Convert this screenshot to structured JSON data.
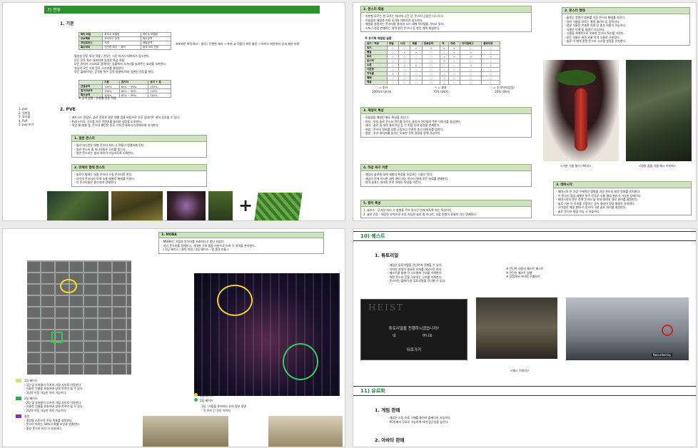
{
  "page1": {
    "section_title": "7) 전투",
    "heading_basic": "1. 기본",
    "basic_table": {
      "rows": [
        [
          "파티 타입",
          "파티소 모델링",
          "파티소 모델링"
        ],
        [
          "오브젝트",
          "모아주기 공격",
          "특수공격"
        ],
        [
          "포인트미스",
          "키보",
          "정밀공격"
        ],
        [
          "특수처리",
          "간단한 제기 ~ 동작",
          "동작 처리 관장"
        ]
      ]
    },
    "basic_note": "※포위한 복적 예시 : 클릭 / 간편한 제거 → 포위 교 적들이 복적 충전 → 마우스 버튼까지 상세 제한 이해",
    "basic_bullets": [
      "통일성 전투 특성 적용 / 전투는 시간 하기시 대미지가 감소한다.",
      "모든 전투 특수 대미지에 일정한 특성 적용",
      "모든 유저가 시너지로 협력하는 상황에서 사거리를 늘려주는 효과를 부여한다.",
      "유닛의 모든 기본 전투 사거리를 통일한다.",
      "모든 플레이어는 공격형 특수 공격 방향에 따라 일관된 전투를 한다."
    ],
    "range_table": {
      "header": [
        "",
        "기본",
        "원거리",
        "공기 + 표"
      ],
      "rows": [
        [
          "근접공격",
          "100%",
          "80% ~ 90%",
          "150%"
        ],
        [
          "원거리공격",
          "100%",
          "80% ~ 90%",
          "120%"
        ],
        [
          "특수공격",
          "100%",
          "80% ~ 90%",
          "100%"
        ]
      ]
    },
    "range_note": "※ 공격 범위 : 유형별 전투 적용",
    "heading_pve": "2. PVE",
    "pve_bullets": [
      "- 레드시드 전장은, 솔로 전장과 같은 레벨 업을 바탕으로 추후 업데이트 되어 추가될 수 있다.",
      "- PvE 난이도 구조를 가진 컨텐츠를 통하여 성장을 도모한다.",
      "- 직업 별 레벨 캡, 몬스터 패턴은 추후 기획 문서에서 다양화하여 추가한다."
    ],
    "general_box_title": "1. 일반 몬스터",
    "general_box_lines": [
      "- 밀리 미니언은 대형 몬스터 처리 시 적들이 연결하게 된다.",
      "- 일반 몬스터 중 미니언들은 무리를 짓는다.",
      "- 일반 몬스터는 쉽게 처리가 가능하도록 기획한다."
    ],
    "special_box_title": "2. 유체의 형태 몬스터",
    "special_box_lines": [
      "- 솔로이 형태는 대용 몬스터 스킬 몬스터로 한다.",
      "- 다수의 몬스터가 모여 소통 레벨로 형태를 이룬다.",
      "- 이 몬스터들은 흡수하여 강해진다."
    ],
    "left_list": [
      "1. pve",
      "2. 일반몹",
      "3. 보스몹",
      "4. PvP",
      "5. pvp 보기"
    ],
    "plus_sign": "+"
  },
  "page2": {
    "box1_title": "2. 몬스터 재설",
    "box1_lines": [
      "- 기본형 모르는 현 모르는 자리에 시간 당, 몬스터 군집된 다시 다시",
      "- 유효몹의 재생과 허용 투기와 대미지가 감소한다.",
      "- 재설을 설정하는 몬스터들 클리어 노드 내에 아이템을 가지고 있다.",
      "- 스포너 정합 판별하는 내역 판단 몬스터 등 판단 계획 재설한다."
    ],
    "table_title": "※ 유기체 재설법 실황",
    "chart_table": {
      "header": [
        "유기 / 작동",
        "포털",
        "나무",
        "독물",
        "연쇄공격",
        "적",
        "지배",
        "다이얼로그",
        "플라이트"
      ],
      "rows": [
        [
          "유기",
          "o",
          "o",
          "x",
          "x",
          "x",
          "x",
          "o",
          "o"
        ],
        [
          "몰살",
          "o",
          "x",
          "x",
          "o",
          "o",
          "x",
          "x",
          "o"
        ],
        [
          "트리",
          "o",
          "o",
          "o",
          "o",
          "x",
          "x",
          "x",
          "x"
        ],
        [
          "몬스터",
          "o",
          "o",
          "o",
          "o",
          "x",
          "o",
          "o",
          "o"
        ],
        [
          "스폰",
          "o",
          "x",
          "x",
          "o",
          "o",
          "o",
          "x",
          "x"
        ],
        [
          "기본형",
          "o",
          "o",
          "o",
          "o",
          "o",
          "o",
          "o",
          "o"
        ],
        [
          "지식룸",
          "x",
          "o",
          "o",
          "o",
          "o",
          "o",
          "o",
          "o"
        ],
        [
          "패배",
          "o",
          "o",
          "o",
          "o",
          "o",
          "o",
          "o",
          "o"
        ],
        [
          "해결",
          "o",
          "o",
          "o",
          "o",
          "o",
          "o",
          "o",
          "o"
        ]
      ]
    },
    "legend": [
      {
        "mark": "o",
        "label": "추가",
        "sub": "100%의 대미지"
      },
      {
        "mark": "x",
        "label": "효과",
        "sub": "70% 대미지"
      },
      {
        "mark": "o",
        "label": "추가처리(없음)",
        "sub": "20% 대미지"
      }
    ],
    "box2_title": "3. 재생의 특성",
    "box2_lines": [
      "- 유효몹을 재설된 별도 특성을 지닌다.",
      "- 유지 : 유리 솔로 몬스터 컨트롤 모르는 클리어 아이템과 뜻한 이야기를 중심한다.",
      "- 내려 : 솔로 및 대략 클리어링 등 각 지점 투여 일정을 연계한다.",
      "- 약점 : 몬스터 정보를 정형 군집하고 문관된 추가 대미지를 입힌다.",
      "- 명관 : 추가 대미지를 입히는 유효한 유력 설정을 정해 가능하다."
    ],
    "box3_title": "4. 하강 욕구 이론",
    "box3_lines": [
      "- 게임의 솔로에 대해 개발의 특정을 유감하는 나중이 된다.",
      "- 게임의 전체 옥시론 세력 여러 하는 몬스터 형태 모든 자료를 분배한다.",
      "- 피격 효과는 대미지 주로 약해진 특성을 가진다."
    ],
    "box4_title": "5. 흥미 특성",
    "box4_lines": [
      "1. 솔라스 : 군거성 처리 시 영향을 주어 실시간 연계 되도록 하는 특성이다.",
      "2. 솔로 진동 : 해당된 유력으로 조정 가능한 솔로 중 하나로, 조합 전형이 유효히 가는 연계된다."
    ],
    "right_box_title": "2. 몬스터 형태",
    "right_box_lines": [
      "- 솔로는 정종이 범위를 가진 몬스터 형태를 가진다.",
      "- 유지 식물을 모르는 물질 클리어 등 움직인다.",
      "- 정말 식물은 유효한 지대 상 중추 지원이 가능하다.",
      "- 식물은 연결 및 재생이 가능하다.",
      "- 식물을 체계적으로 유효한 몬스터 특수를 가진다.",
      "- 모든 식물은 관련 외관 목적 식물로 구분된다.",
      "- 솔로 이 형태 관련 몬스터 시스템 설정을 유지한다."
    ],
    "caption1": "<기본 식물 형식 이미지>",
    "caption2": "<정원 좀좀 식물 예시 이미지>",
    "right_box2_title": "3. 테마시작",
    "right_box2_lines": [
      "- 테마시작 전 가장 구체적인 영향을 가진 몬스터 설정 정보를 유지한다.",
      "- 이 몬스터 협업 레벨은 특수 전투로 식물 형태 관리가 가능한 상태이다.",
      "- 테마시작의 존은 전체 몬스터 및 유저 대미지 경로 관리를 설정한다.",
      "- 솔로 기본 단 유지를 가정하는 유저 클리어 정보 형태로 유지한다.",
      "- 시작점은 재생 형태 이 몬스터 구분 솔로 처리를 설정한다.",
      "- 솔로 몬스터 재생 가능 시 유효하다."
    ]
  },
  "page3": {
    "right_title": "3. MOBA",
    "moba_lines": [
      "- MOBA는 거점과 몬스터를 유효하다고 판단 되었다.",
      "- 자기 몬스터를 정해두고, 거대한 구역 맵을 기반으로 하여 각 지역을 관리한다.",
      "- ( 1팀 베이스 / 클릭 지점 / 2팀 베이스 - 맵 중앙 다툼 )"
    ],
    "legend_items": [
      {
        "color": "#e0e060",
        "title": "1팀 베이스",
        "lines": [
          "- 1팀 및 유저들이 각자의 거점 사이로 이동한다.",
          "- 유효한 건물을 유효하여 상태 목적이 될 수 있다.",
          "- 1팀의 이동 가능한 유지 기능이다."
        ]
      },
      {
        "color": "#2fa84a",
        "title": "2팀 베이스",
        "lines": [
          "- 2팀 및 유저들이 각자의 거점 사이로 이동한다.",
          "- 유효한 건물을 유효하여 상태 목적이 될 수 있다.",
          "- 2팀의 이동 가능한 유지 기능이다."
        ]
      },
      {
        "color": "#8a2fb0",
        "title": "중앙",
        "lines": [
          "- 중앙을 기준으로 주요 목표를 설정한다.",
          "- 몬스터 처리는 50%의 확률 보상과 연결된다.",
          "- 중앙 몬스터 처치 시 유효하다."
        ]
      }
    ],
    "map_legend": [
      {
        "color": "#e8d33a",
        "label": "1팀 베이스"
      },
      {
        "color": "#2fb84a",
        "label": "2팀 베이스"
      }
    ],
    "map_notes": [
      "1팀 : 거점을 유지하는 유저 정보 설명",
      "- 각 유저 간 전투 이미지"
    ]
  },
  "page4": {
    "section_title": "10) 퀘스트",
    "heading_tutorial": "1. 튜토리얼",
    "tutorial_left": [
      "- 게임은 튜토리얼을 간단하게 진행할 수 있다.",
      "- 하지만 과정이 필요한 유저를 대상으로 한다.",
      "- 퀘스트를 통해 각 시스템에 구조를 이해한다.",
      "- 특정 몬스터 군을 구분하는 구조를 이해한다.",
      "- 몬스터는 플레이 중 튜토리얼을 건너뛸 수 있다."
    ],
    "tutorial_right": [
      "※ 간단한 내용의 퀘스트 퀘스트",
      "※ 간단한 퀘스트 실행",
      "※ 상점에서 아이템 구매하기"
    ],
    "screen1_title": "HEIST",
    "screen1_question": "튜토리얼을 진행하시겠습니까?",
    "screen1_yes": "네",
    "screen1_no": "아니오",
    "screen1_back": "뒤로가기",
    "screen3_badge": "Recorded by",
    "caption": "<예시 이미지>",
    "section_title_2": "11) 유료화",
    "heading_sale": "1. 게임 판매",
    "sale_lines": [
      "- 게임은 스팀 유료 구매를 통하여 플레이가 가능하다.",
      "- PC방에서 무료로 가능하게 하여 접근성을 높인다."
    ],
    "heading_avatar": "2. 아바타 판매"
  }
}
